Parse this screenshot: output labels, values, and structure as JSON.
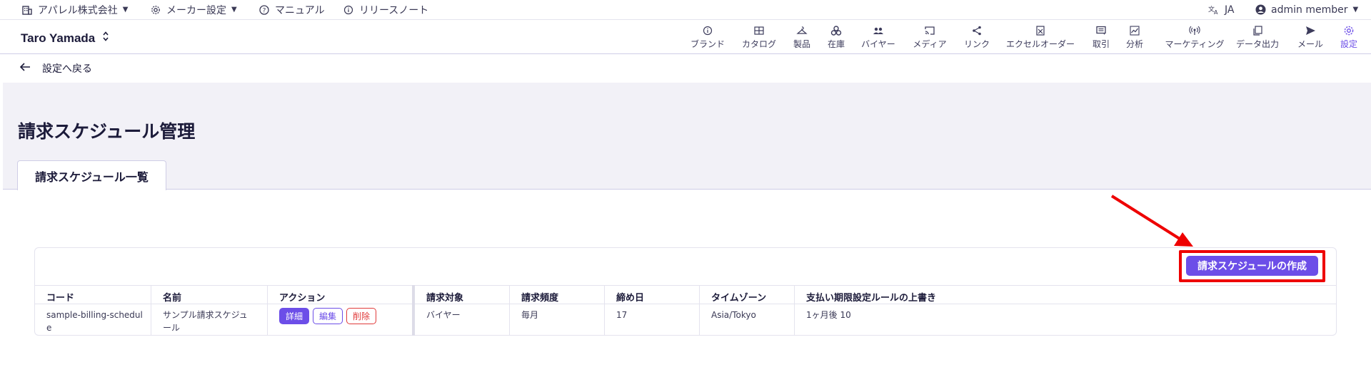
{
  "topbar": {
    "company": "アパレル株式会社",
    "maker_settings": "メーカー設定",
    "manual": "マニュアル",
    "release_notes": "リリースノート",
    "language": "JA",
    "account": "admin member"
  },
  "header": {
    "user_name": "Taro Yamada",
    "nav": [
      {
        "label": "ブランド",
        "icon": "info-icon"
      },
      {
        "label": "カタログ",
        "icon": "catalog-icon"
      },
      {
        "label": "製品",
        "icon": "hanger-icon"
      },
      {
        "label": "在庫",
        "icon": "boxes-icon"
      },
      {
        "label": "バイヤー",
        "icon": "people-icon"
      },
      {
        "label": "メディア",
        "icon": "cast-icon"
      },
      {
        "label": "リンク",
        "icon": "share-icon"
      },
      {
        "label": "エクセルオーダー",
        "icon": "excel-icon"
      },
      {
        "label": "取引",
        "icon": "chat-icon"
      },
      {
        "label": "分析",
        "icon": "chart-icon"
      },
      {
        "label": "マーケティング",
        "icon": "broadcast-icon"
      },
      {
        "label": "データ出力",
        "icon": "copy-icon"
      },
      {
        "label": "メール",
        "icon": "send-icon"
      },
      {
        "label": "設定",
        "icon": "gear-icon"
      }
    ],
    "active_nav": "設定"
  },
  "back": {
    "label": "設定へ戻る"
  },
  "page": {
    "title": "請求スケジュール管理",
    "tab": "請求スケジュール一覧"
  },
  "toolbar": {
    "create_label": "請求スケジュールの作成"
  },
  "table": {
    "columns": [
      "コード",
      "名前",
      "アクション",
      "請求対象",
      "請求頻度",
      "締め日",
      "タイムゾーン",
      "支払い期限設定ルールの上書き"
    ],
    "rows": [
      {
        "code_line1": "sample-billing-schedul",
        "code_line2": "e",
        "name_line1": "サンプル請求スケジュ",
        "name_line2": "ール",
        "actions": {
          "detail": "詳細",
          "edit": "編集",
          "delete": "削除"
        },
        "target": "バイヤー",
        "frequency": "毎月",
        "closing_day": "17",
        "timezone": "Asia/Tokyo",
        "payment_rule": "1ヶ月後 10"
      }
    ]
  },
  "colors": {
    "accent": "#6c4ee8",
    "highlight": "#ee0000",
    "danger": "#e03b3b"
  }
}
